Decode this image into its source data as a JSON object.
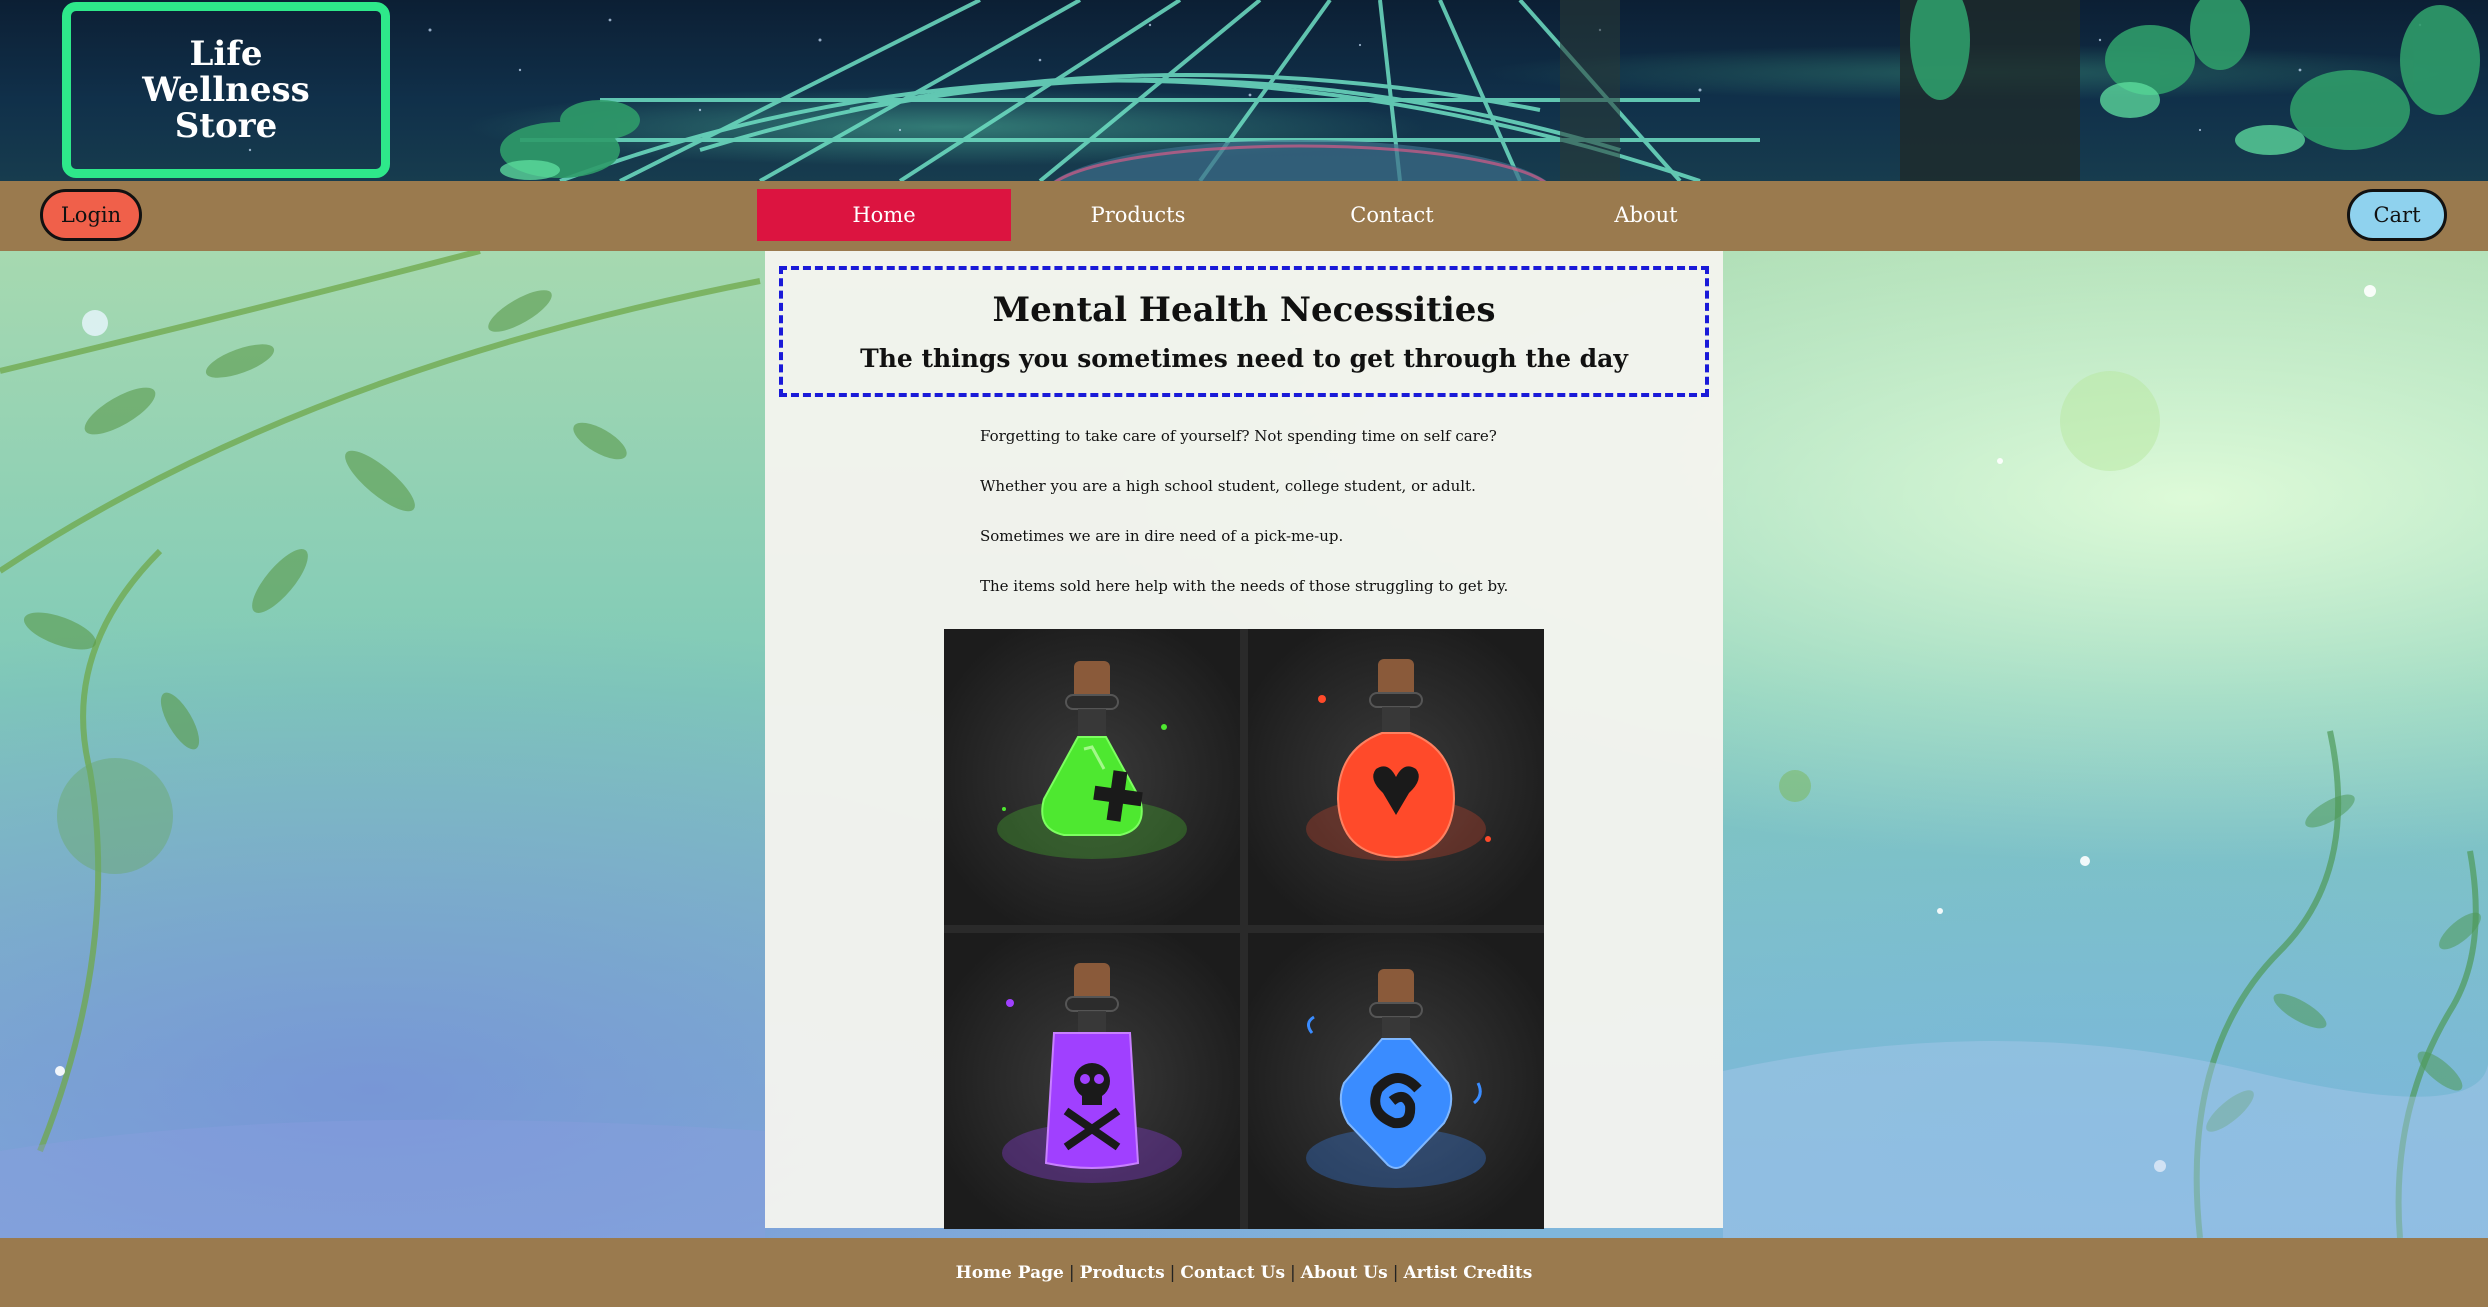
{
  "header": {
    "logo_lines": [
      "Life",
      "Wellness",
      "Store"
    ]
  },
  "nav": {
    "login_label": "Login",
    "cart_label": "Cart",
    "links": [
      {
        "label": "Home",
        "active": true
      },
      {
        "label": "Products",
        "active": false
      },
      {
        "label": "Contact",
        "active": false
      },
      {
        "label": "About",
        "active": false
      }
    ],
    "active_color": "#dc1440",
    "bar_color": "#9a7a4e"
  },
  "main": {
    "title": "Mental Health Necessities",
    "subtitle": "The things you sometimes need to get through the day",
    "paragraphs": [
      "Forgetting to take care of yourself? Not spending time on self care?",
      "Whether you are a high school student, college student, or adult.",
      "Sometimes we are in dire need of a pick-me-up.",
      "The items sold here help with the needs of those struggling to get by."
    ],
    "potions": [
      {
        "icon": "green-potion-plus-icon",
        "color": "#4ee830"
      },
      {
        "icon": "red-potion-heart-icon",
        "color": "#ff4a2a"
      },
      {
        "icon": "purple-potion-skull-icon",
        "color": "#a040ff"
      },
      {
        "icon": "blue-potion-swirl-icon",
        "color": "#3a8cff"
      }
    ]
  },
  "footer": {
    "links": [
      "Home Page",
      "Products",
      "Contact Us",
      "About Us",
      "Artist Credits"
    ],
    "separator": "|"
  }
}
